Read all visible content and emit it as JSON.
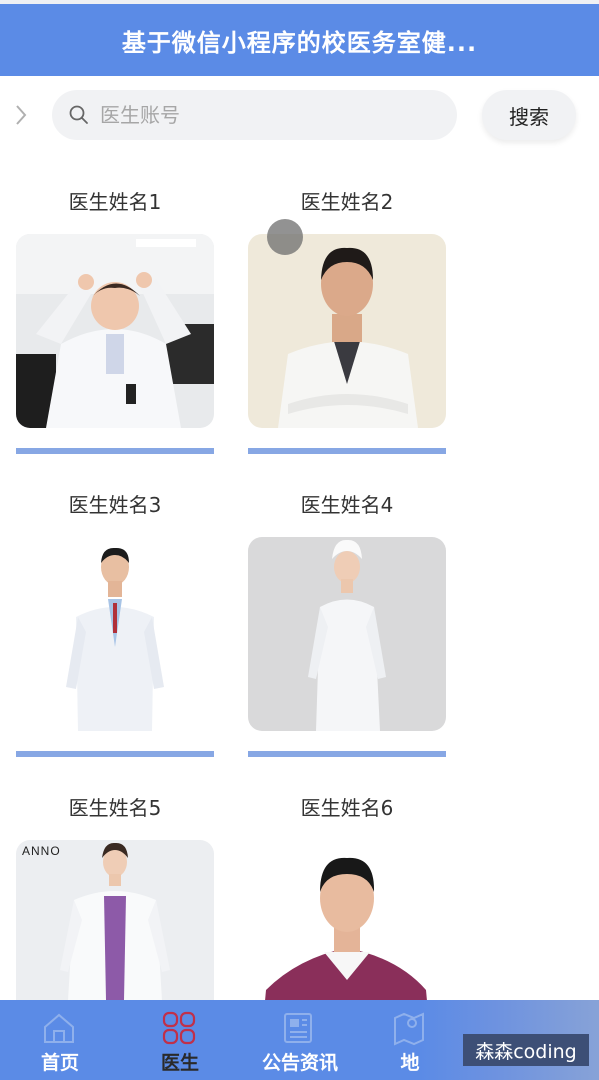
{
  "header": {
    "title": "基于微信小程序的校医务室健..."
  },
  "search": {
    "placeholder": "医生账号",
    "button_label": "搜索"
  },
  "doctors": [
    {
      "name": "医生姓名1"
    },
    {
      "name": "医生姓名2"
    },
    {
      "name": "医生姓名3"
    },
    {
      "name": "医生姓名4"
    },
    {
      "name": "医生姓名5",
      "photo_logo": "ANNO"
    },
    {
      "name": "医生姓名6"
    }
  ],
  "tabbar": {
    "items": [
      {
        "label": "首页",
        "icon": "home-icon",
        "active": false
      },
      {
        "label": "医生",
        "icon": "doctor-icon",
        "active": true
      },
      {
        "label": "公告资讯",
        "icon": "news-icon",
        "active": false
      },
      {
        "label": "地",
        "icon": "map-icon",
        "active": false
      }
    ]
  },
  "watermark": {
    "text": "森森coding"
  },
  "colors": {
    "header_bg": "#5b8be6",
    "tab_active": "#c0304a",
    "card_bar": "#87a7e4"
  }
}
